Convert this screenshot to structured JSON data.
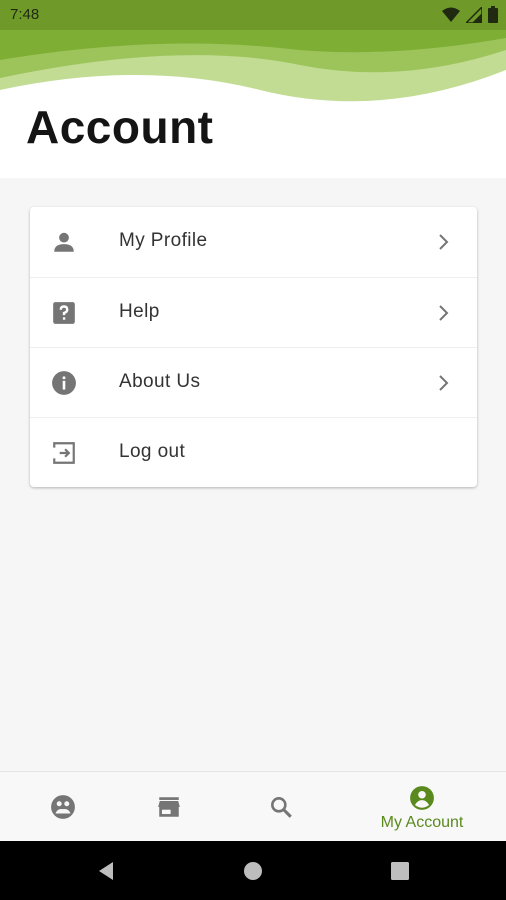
{
  "status_bar": {
    "time": "7:48",
    "icons": [
      "wifi-icon",
      "signal-icon",
      "battery-icon"
    ]
  },
  "header": {
    "title": "Account"
  },
  "menu": {
    "items": [
      {
        "label": "My Profile",
        "icon": "person-icon",
        "has_chevron": true
      },
      {
        "label": "Help",
        "icon": "help-icon",
        "has_chevron": true
      },
      {
        "label": "About Us",
        "icon": "info-icon",
        "has_chevron": true
      },
      {
        "label": "Log out",
        "icon": "logout-icon",
        "has_chevron": false
      }
    ]
  },
  "bottom_nav": {
    "items": [
      {
        "icon": "community-icon",
        "label": "",
        "active": false
      },
      {
        "icon": "store-icon",
        "label": "",
        "active": false
      },
      {
        "icon": "search-icon",
        "label": "",
        "active": false
      },
      {
        "icon": "account-icon",
        "label": "My Account",
        "active": true
      }
    ]
  },
  "colors": {
    "accent": "#5a8a1e",
    "status_bar": "#6f9a2a",
    "icon_gray": "#757575"
  }
}
